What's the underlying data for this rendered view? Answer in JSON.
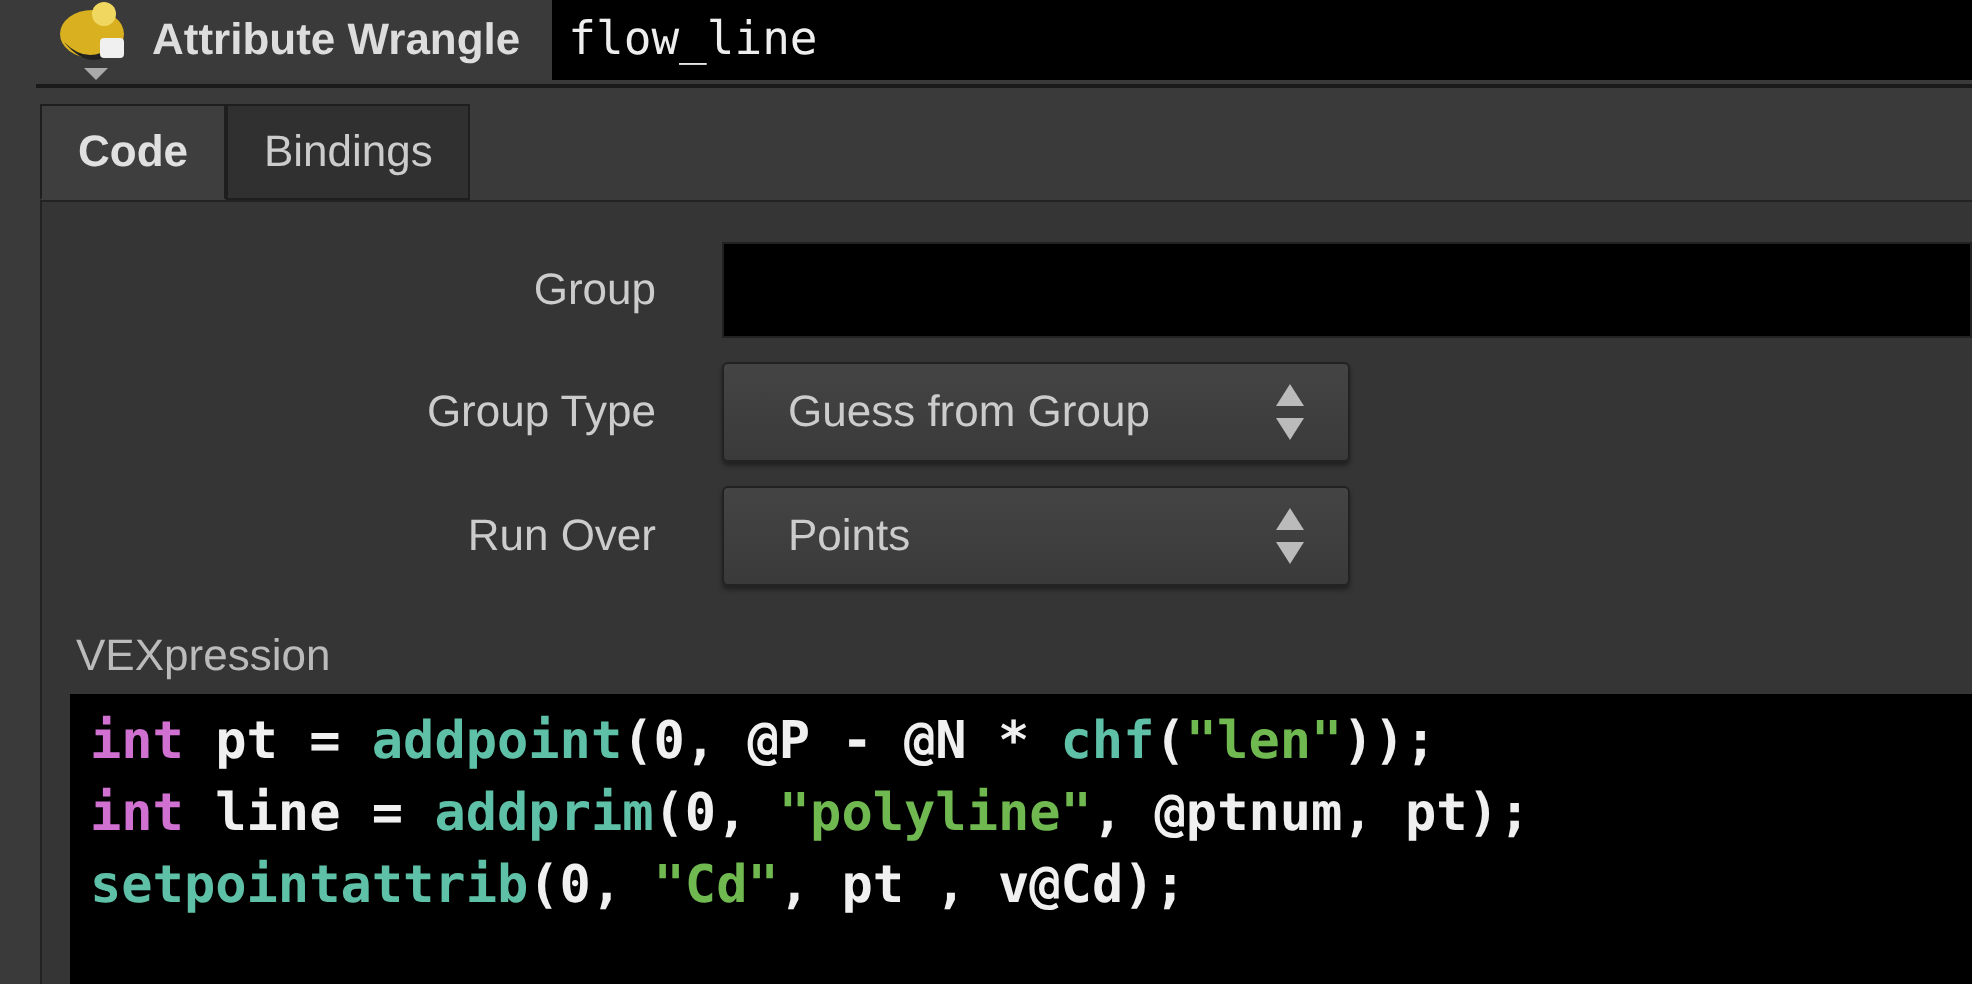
{
  "header": {
    "node_type": "Attribute Wrangle",
    "node_name": "flow_line"
  },
  "tabs": [
    {
      "label": "Code",
      "selected": true
    },
    {
      "label": "Bindings",
      "selected": false
    }
  ],
  "parameters": [
    {
      "kind": "text",
      "label": "Group"
    },
    {
      "kind": "menu",
      "label": "Group Type",
      "value": "Guess from Group"
    },
    {
      "kind": "menu",
      "label": "Run Over",
      "value": "Points"
    }
  ],
  "vexpression": {
    "label": "VEXpression",
    "lines": [
      [
        {
          "kind": "keyword",
          "text": "int"
        },
        {
          "kind": "plain",
          "text": " pt = "
        },
        {
          "kind": "function",
          "text": "addpoint"
        },
        {
          "kind": "plain",
          "text": "(0, @P - @N * "
        },
        {
          "kind": "function",
          "text": "chf"
        },
        {
          "kind": "plain",
          "text": "("
        },
        {
          "kind": "string",
          "text": "\"len\""
        },
        {
          "kind": "plain",
          "text": "));"
        }
      ],
      [
        {
          "kind": "keyword",
          "text": "int"
        },
        {
          "kind": "plain",
          "text": " line = "
        },
        {
          "kind": "function",
          "text": "addprim"
        },
        {
          "kind": "plain",
          "text": "(0, "
        },
        {
          "kind": "string",
          "text": "\"polyline\""
        },
        {
          "kind": "plain",
          "text": ", @ptnum, pt);"
        }
      ],
      [
        {
          "kind": "function",
          "text": "setpointattrib"
        },
        {
          "kind": "plain",
          "text": "(0, "
        },
        {
          "kind": "string",
          "text": "\"Cd\""
        },
        {
          "kind": "plain",
          "text": ", pt , v@Cd);"
        }
      ]
    ]
  }
}
